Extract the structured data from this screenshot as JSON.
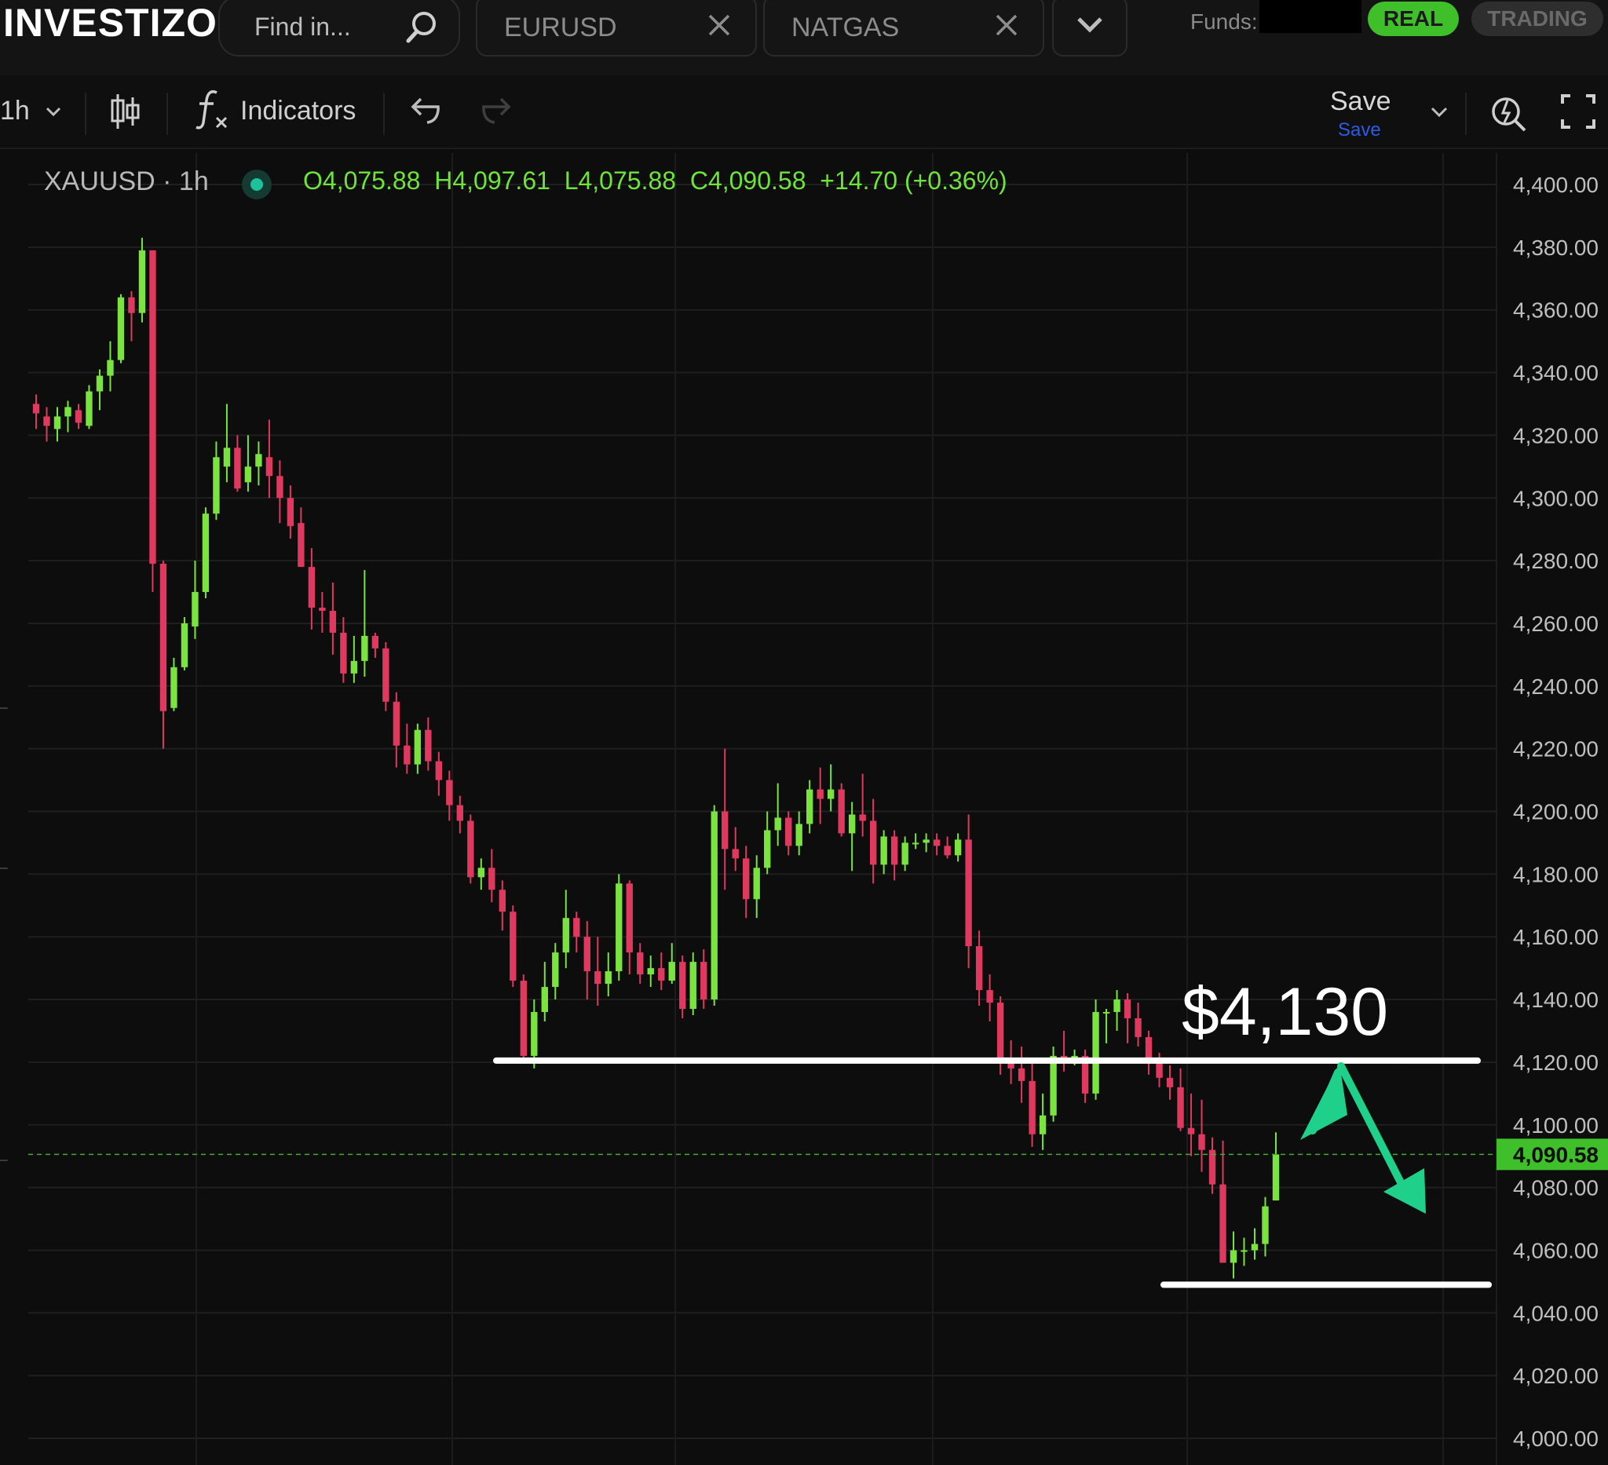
{
  "header": {
    "logo_text": "INVESTIZO",
    "search_placeholder": "Find in...",
    "tabs": [
      {
        "label": "EURUSD"
      },
      {
        "label": "NATGAS"
      }
    ],
    "funds_label": "Funds:",
    "mode_real": "REAL",
    "mode_trading": "TRADING"
  },
  "toolbar": {
    "interval": "1h",
    "indicators_label": "Indicators",
    "save_label": "Save",
    "save_sub_label": "Save"
  },
  "legend": {
    "symbol": "XAUUSD · 1h",
    "open": "O4,075.88",
    "high": "H4,097.61",
    "low": "L4,075.88",
    "close": "C4,090.58",
    "change": "+14.70 (+0.36%)"
  },
  "chart_data": {
    "type": "candlestick",
    "symbol": "XAUUSD",
    "interval": "1h",
    "ylim": [
      4000,
      4400
    ],
    "y_ticks": [
      "4,400.00",
      "4,380.00",
      "4,360.00",
      "4,340.00",
      "4,320.00",
      "4,300.00",
      "4,280.00",
      "4,260.00",
      "4,240.00",
      "4,220.00",
      "4,200.00",
      "4,180.00",
      "4,160.00",
      "4,140.00",
      "4,120.00",
      "4,100.00",
      "4,080.00",
      "4,060.00",
      "4,040.00",
      "4,020.00",
      "4,000.00"
    ],
    "last_price": 4090.58,
    "last_price_label": "4,090.58",
    "up_color": "#7be33f",
    "down_color": "#e0395f",
    "candles": [
      [
        4330,
        4327,
        4322,
        4333
      ],
      [
        4326,
        4323,
        4318,
        4329
      ],
      [
        4322,
        4326,
        4318,
        4329
      ],
      [
        4326,
        4329,
        4321,
        4331
      ],
      [
        4328,
        4324,
        4322,
        4330
      ],
      [
        4323,
        4334,
        4322,
        4336
      ],
      [
        4334,
        4339,
        4328,
        4341
      ],
      [
        4339,
        4344,
        4334,
        4350
      ],
      [
        4344,
        4364,
        4343,
        4365
      ],
      [
        4364,
        4359,
        4350,
        4366
      ],
      [
        4359,
        4379,
        4356,
        4383
      ],
      [
        4379,
        4279,
        4270,
        4379
      ],
      [
        4279,
        4232,
        4220,
        4280
      ],
      [
        4233,
        4246,
        4232,
        4249
      ],
      [
        4246,
        4260,
        4245,
        4262
      ],
      [
        4259,
        4270,
        4255,
        4280
      ],
      [
        4270,
        4295,
        4268,
        4297
      ],
      [
        4295,
        4313,
        4293,
        4318
      ],
      [
        4310,
        4316,
        4305,
        4330
      ],
      [
        4316,
        4303,
        4302,
        4320
      ],
      [
        4305,
        4310,
        4302,
        4320
      ],
      [
        4310,
        4314,
        4304,
        4318
      ],
      [
        4313,
        4307,
        4300,
        4325
      ],
      [
        4307,
        4300,
        4292,
        4312
      ],
      [
        4300,
        4291,
        4287,
        4304
      ],
      [
        4292,
        4278,
        4278,
        4297
      ],
      [
        4278,
        4265,
        4258,
        4284
      ],
      [
        4265,
        4264,
        4257,
        4270
      ],
      [
        4264,
        4257,
        4250,
        4273
      ],
      [
        4257,
        4244,
        4241,
        4262
      ],
      [
        4244,
        4248,
        4241,
        4256
      ],
      [
        4248,
        4256,
        4243,
        4277
      ],
      [
        4256,
        4252,
        4249,
        4257
      ],
      [
        4252,
        4235,
        4232,
        4254
      ],
      [
        4235,
        4221,
        4214,
        4238
      ],
      [
        4221,
        4215,
        4212,
        4228
      ],
      [
        4215,
        4226,
        4212,
        4228
      ],
      [
        4226,
        4216,
        4213,
        4230
      ],
      [
        4216,
        4210,
        4205,
        4219
      ],
      [
        4210,
        4202,
        4197,
        4213
      ],
      [
        4202,
        4197,
        4193,
        4205
      ],
      [
        4197,
        4179,
        4177,
        4199
      ],
      [
        4179,
        4182,
        4175,
        4185
      ],
      [
        4182,
        4175,
        4171,
        4188
      ],
      [
        4175,
        4168,
        4162,
        4178
      ],
      [
        4168,
        4146,
        4144,
        4170
      ],
      [
        4146,
        4122,
        4120,
        4148
      ],
      [
        4122,
        4136,
        4118,
        4140
      ],
      [
        4136,
        4144,
        4133,
        4152
      ],
      [
        4144,
        4155,
        4140,
        4158
      ],
      [
        4155,
        4166,
        4150,
        4175
      ],
      [
        4166,
        4160,
        4155,
        4168
      ],
      [
        4160,
        4149,
        4140,
        4165
      ],
      [
        4149,
        4145,
        4138,
        4160
      ],
      [
        4145,
        4149,
        4141,
        4155
      ],
      [
        4149,
        4177,
        4146,
        4180
      ],
      [
        4177,
        4155,
        4148,
        4178
      ],
      [
        4155,
        4148,
        4145,
        4158
      ],
      [
        4148,
        4150,
        4144,
        4154
      ],
      [
        4150,
        4146,
        4143,
        4155
      ],
      [
        4146,
        4152,
        4145,
        4158
      ],
      [
        4152,
        4137,
        4134,
        4154
      ],
      [
        4137,
        4152,
        4135,
        4155
      ],
      [
        4152,
        4140,
        4137,
        4156
      ],
      [
        4140,
        4200,
        4138,
        4202
      ],
      [
        4200,
        4188,
        4175,
        4220
      ],
      [
        4188,
        4185,
        4181,
        4195
      ],
      [
        4185,
        4172,
        4166,
        4189
      ],
      [
        4172,
        4182,
        4166,
        4186
      ],
      [
        4182,
        4194,
        4180,
        4200
      ],
      [
        4194,
        4198,
        4189,
        4209
      ],
      [
        4198,
        4189,
        4186,
        4200
      ],
      [
        4189,
        4196,
        4186,
        4200
      ],
      [
        4196,
        4207,
        4193,
        4210
      ],
      [
        4207,
        4204,
        4196,
        4214
      ],
      [
        4204,
        4207,
        4200,
        4215
      ],
      [
        4207,
        4193,
        4192,
        4209
      ],
      [
        4193,
        4199,
        4181,
        4203
      ],
      [
        4199,
        4197,
        4192,
        4212
      ],
      [
        4197,
        4183,
        4177,
        4204
      ],
      [
        4183,
        4192,
        4180,
        4194
      ],
      [
        4192,
        4183,
        4178,
        4194
      ],
      [
        4183,
        4190,
        4181,
        4192
      ],
      [
        4190,
        4190,
        4188,
        4193
      ],
      [
        4190,
        4191,
        4187,
        4193
      ],
      [
        4191,
        4189,
        4186,
        4193
      ],
      [
        4189,
        4186,
        4185,
        4192
      ],
      [
        4186,
        4191,
        4184,
        4193
      ],
      [
        4191,
        4157,
        4150,
        4199
      ],
      [
        4157,
        4143,
        4138,
        4162
      ],
      [
        4143,
        4139,
        4133,
        4148
      ],
      [
        4139,
        4121,
        4116,
        4141
      ],
      [
        4121,
        4118,
        4113,
        4127
      ],
      [
        4118,
        4114,
        4107,
        4125
      ],
      [
        4114,
        4097,
        4093,
        4120
      ],
      [
        4097,
        4103,
        4092,
        4110
      ],
      [
        4103,
        4122,
        4101,
        4125
      ],
      [
        4122,
        4121,
        4117,
        4130
      ],
      [
        4121,
        4122,
        4119,
        4124
      ],
      [
        4122,
        4110,
        4107,
        4124
      ],
      [
        4110,
        4136,
        4108,
        4140
      ],
      [
        4136,
        4136,
        4126,
        4137
      ],
      [
        4136,
        4140,
        4130,
        4143
      ],
      [
        4140,
        4134,
        4126,
        4142
      ],
      [
        4134,
        4128,
        4125,
        4139
      ],
      [
        4128,
        4120,
        4116,
        4130
      ],
      [
        4120,
        4115,
        4112,
        4123
      ],
      [
        4115,
        4112,
        4108,
        4119
      ],
      [
        4112,
        4099,
        4098,
        4118
      ],
      [
        4099,
        4097,
        4090,
        4110
      ],
      [
        4097,
        4092,
        4085,
        4108
      ],
      [
        4092,
        4081,
        4078,
        4096
      ],
      [
        4081,
        4056,
        4056,
        4095
      ],
      [
        4056,
        4060,
        4051,
        4066
      ],
      [
        4060,
        4060,
        4055,
        4064
      ],
      [
        4060,
        4062,
        4057,
        4067
      ],
      [
        4062,
        4074,
        4058,
        4077
      ],
      [
        4075.88,
        4090.58,
        4075.88,
        4097.61
      ]
    ],
    "annotations": {
      "resistance_level": 4120,
      "support_level": 4049,
      "target_label": "$4,130"
    }
  }
}
